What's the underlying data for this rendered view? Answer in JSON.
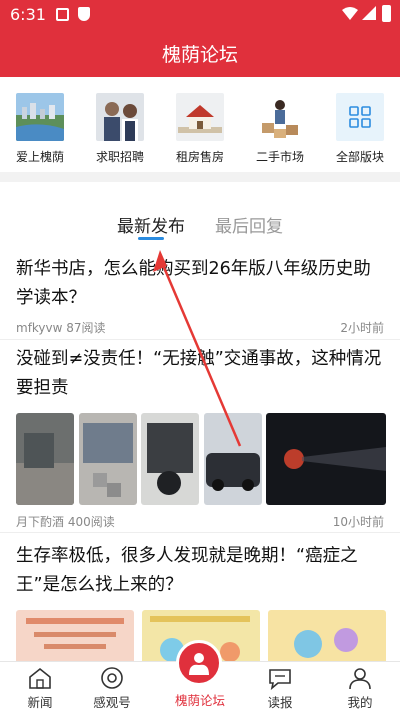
{
  "status_bar": {
    "time": "6:31"
  },
  "header": {
    "title": "槐荫论坛"
  },
  "shortcuts": [
    {
      "label": "爱上槐荫",
      "icon": "city-photo"
    },
    {
      "label": "求职招聘",
      "icon": "job-photo"
    },
    {
      "label": "租房售房",
      "icon": "house-photo"
    },
    {
      "label": "二手市场",
      "icon": "market-photo"
    },
    {
      "label": "全部版块",
      "icon": "grid-icon"
    }
  ],
  "tabs": [
    {
      "label": "最新发布",
      "active": true
    },
    {
      "label": "最后回复",
      "active": false
    }
  ],
  "posts": [
    {
      "title": "新华书店，怎么能购买到26年版八年级历史助学读本？",
      "meta_left": "mfkyvw 87阅读",
      "meta_right": "2小时前"
    },
    {
      "title": "没碰到≠没责任！“无接触”交通事故，这种情况要担责",
      "meta_left": "月下酌酒 400阅读",
      "meta_right": "10小时前"
    },
    {
      "title": "生存率极低，很多人发现就是晚期！“癌症之王”是怎么找上来的？",
      "meta_left": "",
      "meta_right": ""
    }
  ],
  "bottom_nav": [
    {
      "label": "新闻",
      "icon": "home-icon",
      "active": false
    },
    {
      "label": "感观号",
      "icon": "eye-icon",
      "active": false
    },
    {
      "label": "槐荫论坛",
      "icon": "forum-icon",
      "active": true
    },
    {
      "label": "读报",
      "icon": "chat-icon",
      "active": false
    },
    {
      "label": "我的",
      "icon": "person-icon",
      "active": false
    }
  ],
  "colors": {
    "brand_red": "#e0303c",
    "tab_indicator": "#2b8ce0",
    "arrow_red": "#e53935"
  }
}
